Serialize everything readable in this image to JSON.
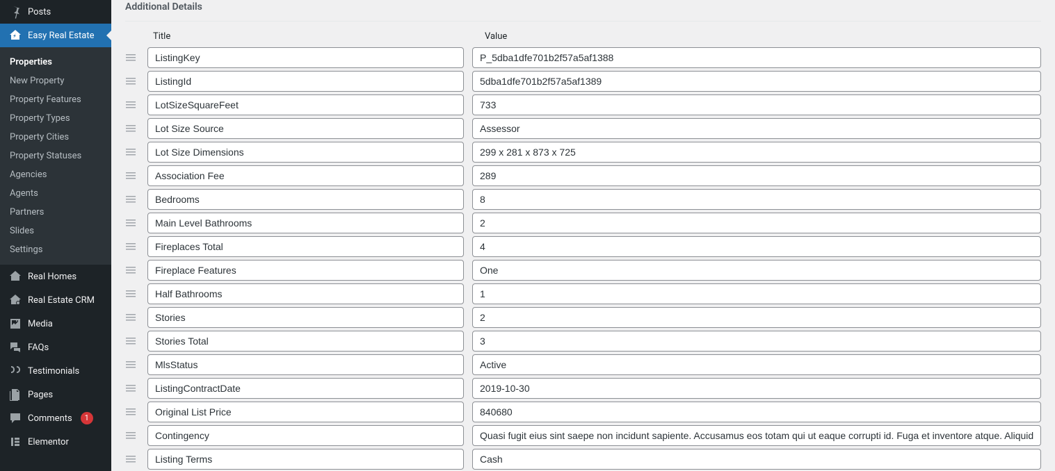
{
  "panel_title": "Additional Details",
  "columns": {
    "title": "Title",
    "value": "Value"
  },
  "sidebar": {
    "top": [
      {
        "icon": "pin-icon",
        "label": "Posts"
      },
      {
        "icon": "house-arrow-icon",
        "label": "Easy Real Estate",
        "active": true
      }
    ],
    "submenu": [
      "Properties",
      "New Property",
      "Property Features",
      "Property Types",
      "Property Cities",
      "Property Statuses",
      "Agencies",
      "Agents",
      "Partners",
      "Slides",
      "Settings"
    ],
    "rest": [
      {
        "icon": "house-icon",
        "label": "Real Homes"
      },
      {
        "icon": "house-circle-icon",
        "label": "Real Estate CRM"
      },
      {
        "icon": "media-icon",
        "label": "Media"
      },
      {
        "icon": "chat-icon",
        "label": "FAQs"
      },
      {
        "icon": "quotes-icon",
        "label": "Testimonials"
      },
      {
        "icon": "pages-icon",
        "label": "Pages"
      },
      {
        "icon": "comment-icon",
        "label": "Comments",
        "badge": "1"
      },
      {
        "icon": "elementor-icon",
        "label": "Elementor"
      }
    ]
  },
  "rows": [
    {
      "title": "ListingKey",
      "value": "P_5dba1dfe701b2f57a5af1388"
    },
    {
      "title": "ListingId",
      "value": "5dba1dfe701b2f57a5af1389"
    },
    {
      "title": "LotSizeSquareFeet",
      "value": "733"
    },
    {
      "title": "Lot Size Source",
      "value": "Assessor"
    },
    {
      "title": "Lot Size Dimensions",
      "value": "299 x 281 x 873 x 725"
    },
    {
      "title": "Association Fee",
      "value": "289"
    },
    {
      "title": "Bedrooms",
      "value": "8"
    },
    {
      "title": "Main Level Bathrooms",
      "value": "2"
    },
    {
      "title": "Fireplaces Total",
      "value": "4"
    },
    {
      "title": "Fireplace Features",
      "value": "One"
    },
    {
      "title": "Half Bathrooms",
      "value": "1"
    },
    {
      "title": "Stories",
      "value": "2"
    },
    {
      "title": "Stories Total",
      "value": "3"
    },
    {
      "title": "MlsStatus",
      "value": "Active"
    },
    {
      "title": "ListingContractDate",
      "value": "2019-10-30"
    },
    {
      "title": "Original List Price",
      "value": "840680"
    },
    {
      "title": "Contingency",
      "value": "Quasi fugit eius sint saepe non incidunt sapiente. Accusamus eos totam qui ut eaque corrupti id. Fuga et inventore atque. Aliquid"
    },
    {
      "title": "Listing Terms",
      "value": "Cash"
    }
  ]
}
